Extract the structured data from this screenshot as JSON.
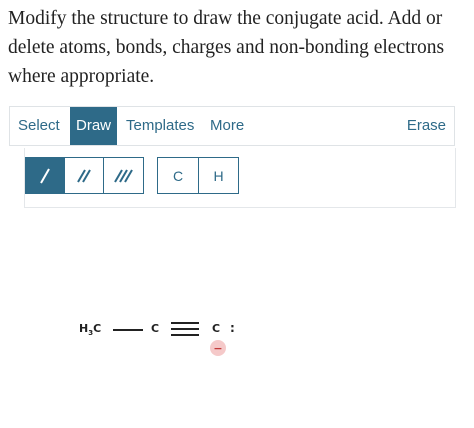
{
  "question": {
    "text": "Modify the structure to draw the conjugate acid. Add or delete atoms, bonds, charges and non-bonding electrons where appropriate."
  },
  "toolbar": {
    "tabs": [
      {
        "label": "Select",
        "active": false
      },
      {
        "label": "Draw",
        "active": true
      },
      {
        "label": "Templates",
        "active": false
      },
      {
        "label": "More",
        "active": false
      }
    ],
    "erase_label": "Erase"
  },
  "draw_tools": {
    "bonds": [
      {
        "name": "single-bond",
        "glyph": "/",
        "active": true
      },
      {
        "name": "double-bond",
        "glyph": "//",
        "active": false
      },
      {
        "name": "triple-bond",
        "glyph": "///",
        "active": false
      }
    ],
    "atoms": [
      "C",
      "H"
    ]
  },
  "molecule": {
    "methyl_label": "H",
    "methyl_subscript": "3",
    "methyl_c": "C",
    "carbon1": "C",
    "carbon2": "C",
    "lone_pair": ":",
    "charge": "−"
  },
  "colors": {
    "accent": "#2e6a88",
    "charge_bg": "#f5c9c9",
    "charge_fg": "#c23a3a"
  }
}
